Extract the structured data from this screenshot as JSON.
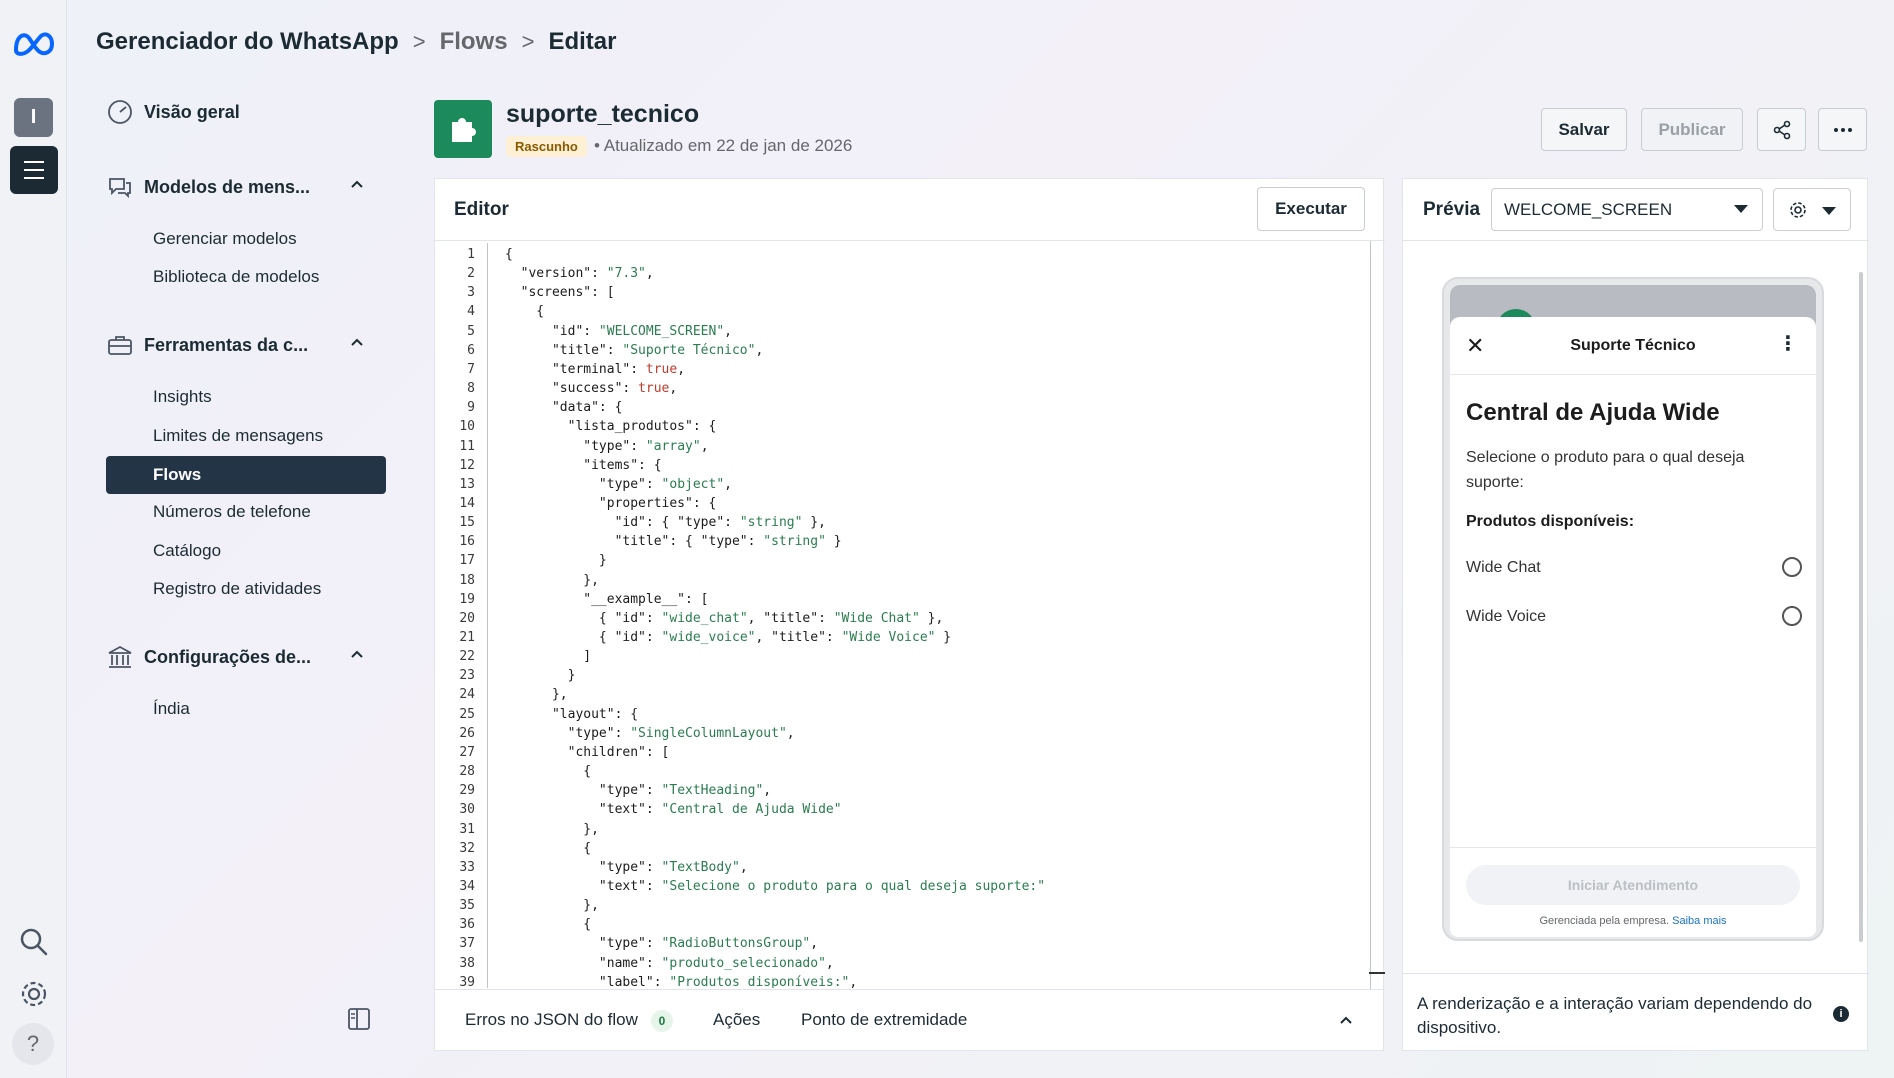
{
  "breadcrumb": {
    "app": "Gerenciador do WhatsApp",
    "section": "Flows",
    "page": "Editar"
  },
  "rail": {
    "avatar_letter": "I",
    "help": "?"
  },
  "nav": {
    "overview": "Visão geral",
    "templates": {
      "title": "Modelos de mens...",
      "items": [
        "Gerenciar modelos",
        "Biblioteca de modelos"
      ]
    },
    "tools": {
      "title": "Ferramentas da c...",
      "items": [
        "Insights",
        "Limites de mensagens",
        "Flows",
        "Números de telefone",
        "Catálogo",
        "Registro de atividades"
      ],
      "active": "Flows"
    },
    "settings": {
      "title": "Configurações de...",
      "items": [
        "Índia"
      ]
    }
  },
  "flow": {
    "name": "suporte_tecnico",
    "status": "Rascunho",
    "updated": "• Atualizado em 22 de jan de 2026"
  },
  "actions": {
    "save": "Salvar",
    "publish": "Publicar"
  },
  "editor": {
    "title": "Editor",
    "run": "Executar",
    "footer": {
      "errors": "Erros no JSON do flow",
      "errors_count": "0",
      "actions": "Ações",
      "endpoint": "Ponto de extremidade"
    }
  },
  "code_lines": [
    "{",
    "  \"version\": \"7.3\",",
    "  \"screens\": [",
    "    {",
    "      \"id\": \"WELCOME_SCREEN\",",
    "      \"title\": \"Suporte Técnico\",",
    "      \"terminal\": true,",
    "      \"success\": true,",
    "      \"data\": {",
    "        \"lista_produtos\": {",
    "          \"type\": \"array\",",
    "          \"items\": {",
    "            \"type\": \"object\",",
    "            \"properties\": {",
    "              \"id\": { \"type\": \"string\" },",
    "              \"title\": { \"type\": \"string\" }",
    "            }",
    "          },",
    "          \"__example__\": [",
    "            { \"id\": \"wide_chat\", \"title\": \"Wide Chat\" },",
    "            { \"id\": \"wide_voice\", \"title\": \"Wide Voice\" }",
    "          ]",
    "        }",
    "      },",
    "      \"layout\": {",
    "        \"type\": \"SingleColumnLayout\",",
    "        \"children\": [",
    "          {",
    "            \"type\": \"TextHeading\",",
    "            \"text\": \"Central de Ajuda Wide\"",
    "          },",
    "          {",
    "            \"type\": \"TextBody\",",
    "            \"text\": \"Selecione o produto para o qual deseja suporte:\"",
    "          },",
    "          {",
    "            \"type\": \"RadioButtonsGroup\",",
    "            \"name\": \"produto_selecionado\",",
    "            \"label\": \"Produtos disponíveis:\","
  ],
  "preview": {
    "title": "Prévia",
    "screen": "WELCOME_SCREEN",
    "phone": {
      "header": "Suporte Técnico",
      "heading": "Central de Ajuda Wide",
      "body": "Selecione o produto para o qual deseja suporte:",
      "label": "Produtos disponíveis:",
      "options": [
        "Wide Chat",
        "Wide Voice"
      ],
      "cta": "Iniciar Atendimento",
      "managed": "Gerenciada pela empresa.",
      "learn_more": "Saiba mais"
    },
    "note": "A renderização e a interação variam dependendo do dispositivo."
  },
  "colors": {
    "brand_green": "#1c8a5a",
    "active_nav": "#243447",
    "string": "#2a7d4f",
    "boolean": "#c0392b"
  }
}
